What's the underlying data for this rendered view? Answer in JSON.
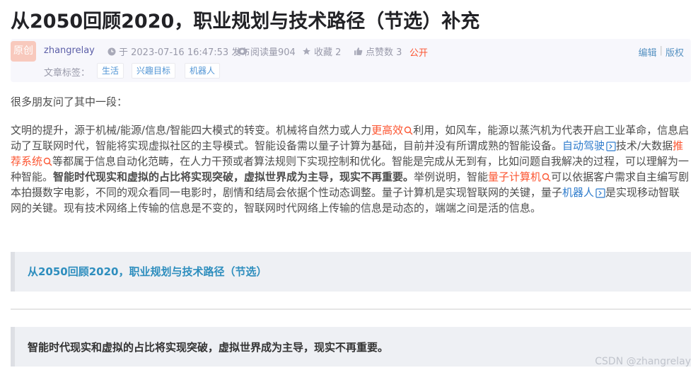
{
  "article": {
    "title": "从2050回顾2020，职业规划与技术路径（节选）补充"
  },
  "meta": {
    "badge": "原创",
    "author": "zhangrelay",
    "published": "于 2023-07-16 16:47:53 发布",
    "views": "阅读量904",
    "favorites": "收藏 2",
    "likes": "点赞数 3",
    "visibility": "公开",
    "edit_link": "编辑",
    "copyright_link": "版权",
    "separator": "|",
    "tags_label": "文章标签：",
    "tags": [
      "生活",
      "兴趣目标",
      "机器人"
    ]
  },
  "content": {
    "intro": "很多朋友问了其中一段：",
    "p1_a": "文明的提升，源于机械/能源/信息/智能四大模式的转变。机械将自然力或人力",
    "kw_efficiency": "更高效",
    "p1_b": "利用，如风车，能源以蒸汽机为代表开启工业革命，信息启动了互联网时代，智能将实现虚拟社区的主导模式。智能设备需以量子计算为基础，目前并没有所谓成熟的智能设备。",
    "kw_autodrive": "自动驾驶",
    "p1_c": "技术/大数据",
    "kw_recommend": "推荐系统",
    "p1_d": "等都属于信息自动化范畴，在人力干预或者算法规则下实现控制和优化。智能是完成从无到有，比如问题自我解决的过程，可以理解为一种智能。",
    "p1_bold": "智能时代现实和虚拟的占比将实现突破，虚拟世界成为主导，现实不再重要。",
    "p1_e": "举例说明，智能",
    "kw_quantum": "量子计算机",
    "p1_f": "可以依据客户需求自主编写剧本拍摄数字电影，不同的观众看同一电影时，剧情和结局会依据个性动态调整。量子计算机是实现智联网的关键，量子",
    "kw_robot": "机器人",
    "p1_g": "是实现移动智联网的关键。现有技术网络上传输的信息是不变的，智联网时代网络上传输的信息是动态的，端端之间是活的信息。",
    "quote_link": "从2050回顾2020，职业规划与技术路径（节选）",
    "quote_bold": "智能时代现实和虚拟的占比将实现突破，虚拟世界成为主导，现实不再重要。"
  },
  "watermark": "CSDN @zhangrelay",
  "colors": {
    "accent_red": "#fc5531",
    "link_blue": "#2d7bcc",
    "quote_link": "#2e8ebe"
  }
}
